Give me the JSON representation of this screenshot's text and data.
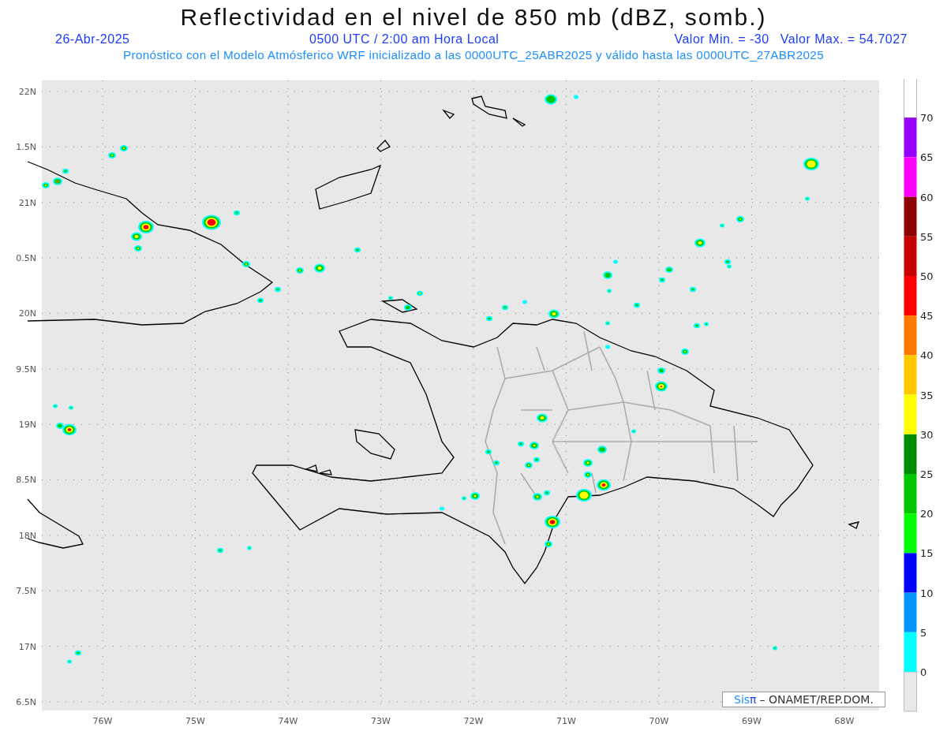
{
  "title": "Reflectividad en el nivel de 850 mb (dBZ, somb.)",
  "date": "26-Abr-2025",
  "time": "0500 UTC / 2:00 am Hora Local",
  "value_min": "Valor Min. = -30",
  "value_max": "Valor Max. = 54.7027",
  "forecast_note": "Pronóstico con el Modelo Atmósferico WRF inicializado a las 0000UTC_25ABR2025 y válido hasta las  0000UTC_27ABR2025",
  "map": {
    "y_labels": [
      "22N",
      "1.5N",
      "21N",
      "0.5N",
      "20N",
      "9.5N",
      "19N",
      "8.5N",
      "18N",
      "7.5N",
      "17N",
      "6.5N"
    ],
    "x_labels": [
      "76W",
      "75W",
      "74W",
      "73W",
      "72W",
      "71W",
      "70W",
      "69W",
      "68W"
    ]
  },
  "colorbar": {
    "labels": [
      "70",
      "65",
      "60",
      "55",
      "50",
      "45",
      "40",
      "35",
      "30",
      "25",
      "20",
      "15",
      "10",
      "5",
      "0"
    ],
    "segments": [
      {
        "color": "#9600ff"
      },
      {
        "color": "#ff00ff"
      },
      {
        "color": "#8c0000"
      },
      {
        "color": "#c80000"
      },
      {
        "color": "#ff0000"
      },
      {
        "color": "#ff7800"
      },
      {
        "color": "#ffc800"
      },
      {
        "color": "#ffff00"
      },
      {
        "color": "#008c00"
      },
      {
        "color": "#00c800"
      },
      {
        "color": "#00ff00"
      },
      {
        "color": "#0000ff"
      },
      {
        "color": "#0096ff"
      },
      {
        "color": "#00ffff"
      }
    ]
  },
  "credit": {
    "brand": "Sis",
    "brand_mark": "π",
    "text": "– ONAMET/REP.DOM."
  }
}
